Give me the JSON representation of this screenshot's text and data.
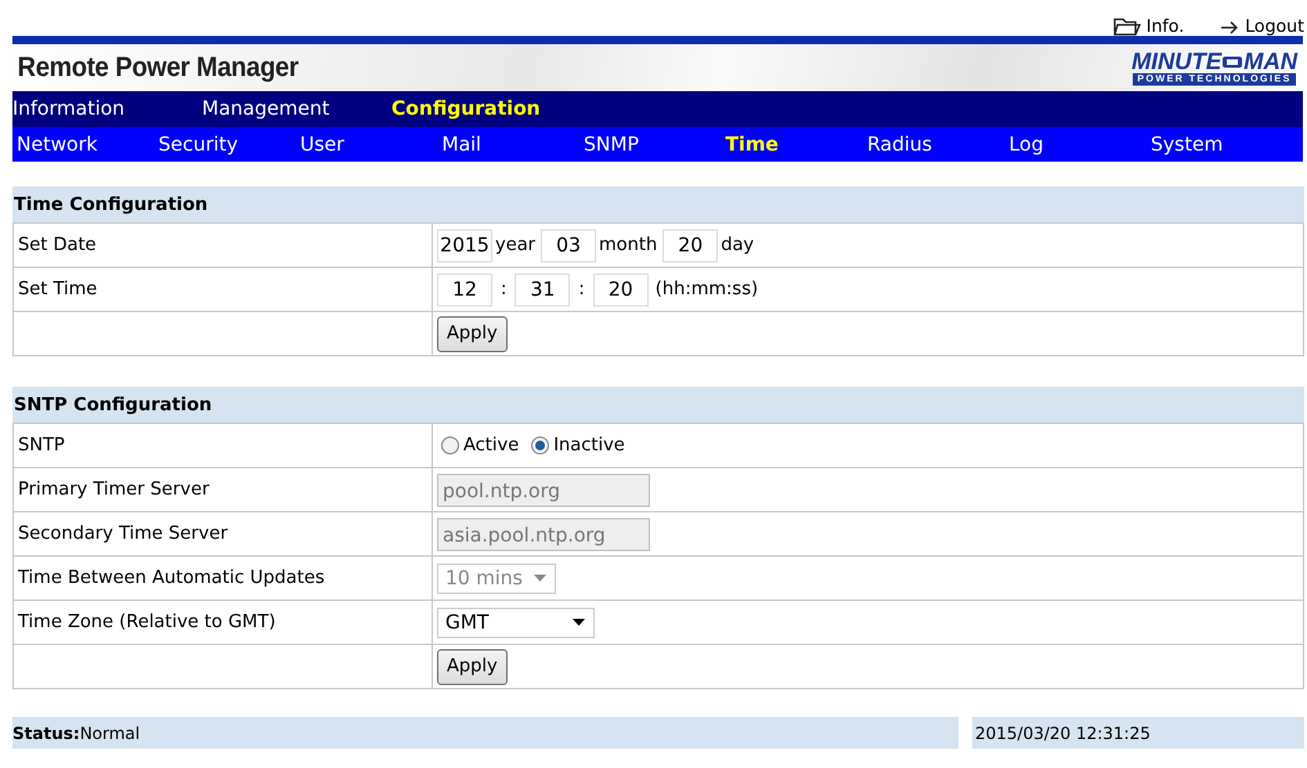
{
  "top_links": [
    {
      "kind": "folder",
      "label": "Info."
    },
    {
      "kind": "arrow",
      "label": "Logout"
    }
  ],
  "header": {
    "title": "Remote Power Manager",
    "logo": {
      "left": "MINUTE",
      "right": "MAN",
      "tagline": "POWER TECHNOLOGIES"
    }
  },
  "menu": [
    {
      "label": "Information",
      "selected": false
    },
    {
      "label": "Management",
      "selected": false
    },
    {
      "label": "Configuration",
      "selected": true
    }
  ],
  "submenu": [
    {
      "label": "Network",
      "selected": false
    },
    {
      "label": "Security",
      "selected": false
    },
    {
      "label": "User",
      "selected": false
    },
    {
      "label": "Mail",
      "selected": false
    },
    {
      "label": "SNMP",
      "selected": false
    },
    {
      "label": "Time",
      "selected": true
    },
    {
      "label": "Radius",
      "selected": false
    },
    {
      "label": "Log",
      "selected": false
    },
    {
      "label": "System",
      "selected": false
    }
  ],
  "time_config": {
    "title": "Time Configuration",
    "set_date": {
      "label": "Set Date",
      "year": "2015",
      "year_unit": "year",
      "month": "03",
      "month_unit": "month",
      "day": "20",
      "day_unit": "day"
    },
    "set_time": {
      "label": "Set Time",
      "hours": "12",
      "sep1": ":",
      "minutes": "31",
      "sep2": ":",
      "seconds": "20",
      "format": "(hh:mm:ss)"
    },
    "button": "Apply"
  },
  "sntp_config": {
    "title": "SNTP Configuration",
    "rows": [
      {
        "kind": "radio",
        "label": "SNTP",
        "options": [
          {
            "label": "Active",
            "selected": false
          },
          {
            "label": "Inactive",
            "selected": true
          }
        ]
      },
      {
        "kind": "text",
        "label": "Primary Timer Server",
        "value": "pool.ntp.org",
        "disabled": true
      },
      {
        "kind": "text",
        "label": "Secondary Time Server",
        "value": "asia.pool.ntp.org",
        "disabled": true
      },
      {
        "kind": "select",
        "label": "Time Between Automatic Updates",
        "value": "10 mins",
        "disabled": true
      },
      {
        "kind": "select",
        "label": "Time Zone (Relative to GMT)",
        "value": "GMT",
        "disabled": false
      }
    ],
    "button": "Apply"
  },
  "status_bar": {
    "status": "**Status:**Normal",
    "datetime": "2015/03/20 12:31:25"
  }
}
